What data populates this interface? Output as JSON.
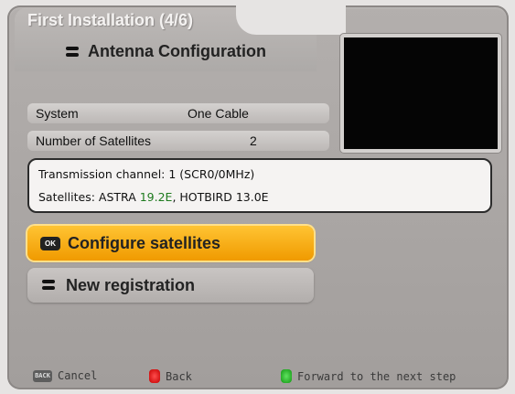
{
  "header": {
    "title": "First Installation (4/6)",
    "subtitle": "Antenna Configuration"
  },
  "settings": [
    {
      "label": "System",
      "value": "One Cable"
    },
    {
      "label": "Number of Satellites",
      "value": "2"
    }
  ],
  "info": {
    "line1": "Transmission channel: 1  (SCR0/0MHz)",
    "line2_prefix": "Satellites: ASTRA ",
    "line2_highlight": "19.2E",
    "line2_suffix": ", HOTBIRD 13.0E"
  },
  "buttons": {
    "configure_icon": "OK",
    "configure": "Configure satellites",
    "new_registration": "New registration"
  },
  "footer": {
    "back_key_label": "BACK",
    "cancel": "Cancel",
    "back": "Back",
    "forward": "Forward to the next step"
  },
  "colors": {
    "accent_orange": "#f7a800",
    "highlight_text": "#1e7a1e",
    "red_key": "#d01010",
    "green_key": "#20b020"
  }
}
